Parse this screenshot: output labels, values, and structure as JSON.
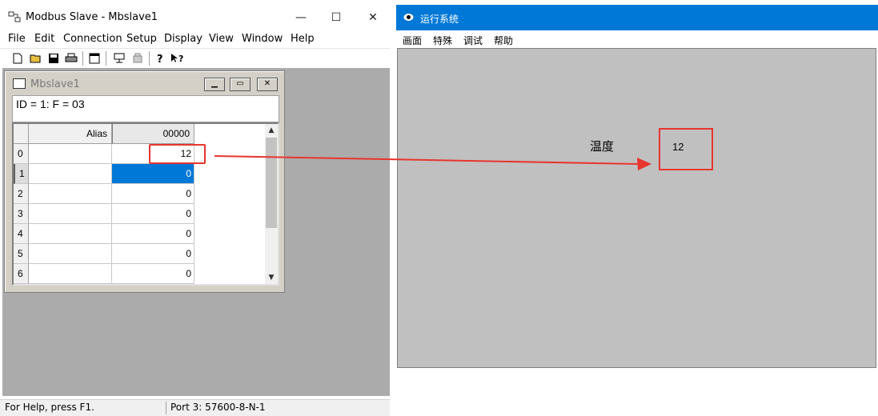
{
  "modbus": {
    "title": "Modbus Slave - Mbslave1",
    "window_controls": {
      "minimize": "—",
      "maximize": "☐",
      "close": "✕"
    },
    "menu": [
      "File",
      "Edit",
      "Connection",
      "Setup",
      "Display",
      "View",
      "Window",
      "Help"
    ],
    "toolbar_icons": [
      "new-icon",
      "open-icon",
      "save-icon",
      "print-icon",
      "window-icon",
      "connect-icon",
      "disconnect-icon",
      "help-icon",
      "context-help-icon"
    ],
    "child": {
      "title": "Mbslave1",
      "info": "ID = 1: F = 03",
      "columns": {
        "alias": "Alias",
        "register": "00000"
      },
      "rows": [
        {
          "index": "0",
          "alias": "",
          "value": "12"
        },
        {
          "index": "1",
          "alias": "",
          "value": "0"
        },
        {
          "index": "2",
          "alias": "",
          "value": "0"
        },
        {
          "index": "3",
          "alias": "",
          "value": "0"
        },
        {
          "index": "4",
          "alias": "",
          "value": "0"
        },
        {
          "index": "5",
          "alias": "",
          "value": "0"
        },
        {
          "index": "6",
          "alias": "",
          "value": "0"
        }
      ]
    },
    "status": {
      "help": "For Help, press F1.",
      "port": "Port 3: 57600-8-N-1"
    }
  },
  "runtime": {
    "title": "运行系统",
    "menu": [
      "画面",
      "特殊",
      "调试",
      "帮助"
    ],
    "temperature_label": "温度",
    "temperature_value": "12"
  },
  "colors": {
    "accent": "#0078d7",
    "annotation": "#e8352e",
    "client_gray": "#c0c0c0",
    "mdi_gray": "#ababab"
  }
}
